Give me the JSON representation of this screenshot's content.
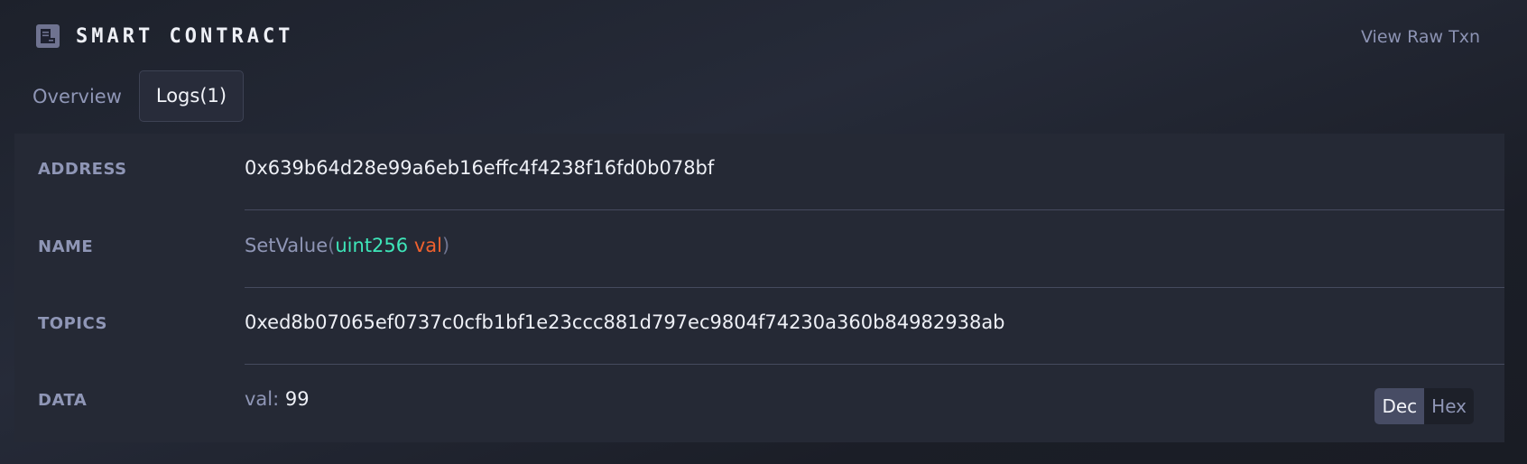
{
  "header": {
    "title": "SMART CONTRACT",
    "icon": "document-icon",
    "raw_link": "View Raw Txn"
  },
  "tabs": [
    {
      "label": "Overview",
      "active": false
    },
    {
      "label": "Logs(1)",
      "active": true
    }
  ],
  "log": {
    "address": {
      "label": "ADDRESS",
      "value": "0x639b64d28e99a6eb16effc4f4238f16fd0b078bf"
    },
    "name": {
      "label": "NAME",
      "function": "SetValue",
      "open_paren": "(",
      "param_type": "uint256",
      "param_name": "val",
      "close_paren": ")"
    },
    "topics": {
      "label": "TOPICS",
      "value": "0xed8b07065ef0737c0cfb1bf1e23ccc881d797ec9804f74230a360b84982938ab"
    },
    "data": {
      "label": "DATA",
      "key": "val:",
      "value": "99",
      "format_options": [
        "Dec",
        "Hex"
      ],
      "selected_format": "Dec"
    }
  },
  "colors": {
    "accent_type": "#3ee6b9",
    "accent_param": "#f0612e",
    "muted_text": "#8f96b6",
    "panel_bg": "#252935"
  }
}
